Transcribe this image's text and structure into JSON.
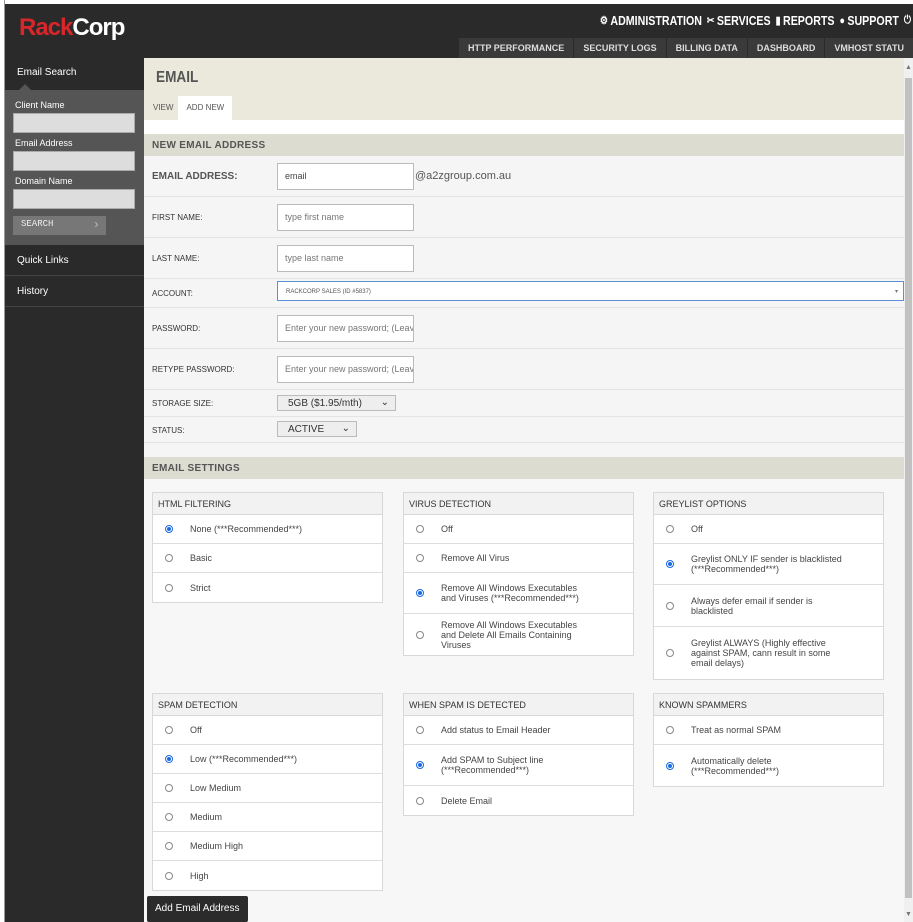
{
  "logo": {
    "part1": "Rack",
    "part2": "Corp"
  },
  "mainnav": [
    {
      "icon": "gear-icon",
      "glyph": "⚙",
      "label": "ADMINISTRATION"
    },
    {
      "icon": "tools-icon",
      "glyph": "✂",
      "label": "SERVICES"
    },
    {
      "icon": "bar-chart-icon",
      "glyph": "▮",
      "label": "REPORTS"
    },
    {
      "icon": "user-icon",
      "glyph": "●",
      "label": "SUPPORT"
    },
    {
      "icon": "power-icon",
      "glyph": "⏻",
      "label": ""
    }
  ],
  "subnav": [
    "HTTP PERFORMANCE",
    "SECURITY LOGS",
    "BILLING DATA",
    "DASHBOARD",
    "VMHOST STATU"
  ],
  "sidebar": {
    "header": "Email Search",
    "fields": [
      "Client Name",
      "Email Address",
      "Domain Name"
    ],
    "search_label": "SEARCH",
    "links": [
      "Quick Links",
      "History"
    ]
  },
  "page": {
    "title": "EMAIL",
    "tabs": [
      "VIEW",
      "ADD NEW"
    ],
    "active_tab": 1
  },
  "form": {
    "section": "NEW EMAIL ADDRESS",
    "email_label": "EMAIL ADDRESS:",
    "email_value": "email",
    "domain": "@a2zgroup.com.au",
    "first_label": "FIRST NAME:",
    "first_placeholder": "type first name",
    "last_label": "LAST NAME:",
    "last_placeholder": "type last name",
    "account_label": "ACCOUNT:",
    "account_value": "RACKCORP SALES (ID #5837)",
    "password_label": "PASSWORD:",
    "password_placeholder": "Enter your new password; (Leave",
    "retype_label": "RETYPE PASSWORD:",
    "retype_placeholder": "Enter your new password; (Leave",
    "storage_label": "STORAGE SIZE:",
    "storage_value": "5GB ($1.95/mth)",
    "status_label": "STATUS:",
    "status_value": "ACTIVE"
  },
  "settings": {
    "section": "EMAIL SETTINGS",
    "groups": [
      {
        "title": "HTML FILTERING",
        "selected": 0,
        "options": [
          "None (***Recommended***)",
          "Basic",
          "Strict"
        ]
      },
      {
        "title": "VIRUS DETECTION",
        "selected": 2,
        "options": [
          "Off",
          "Remove All Virus",
          "Remove All Windows Executables and Viruses (***Recommended***)",
          "Remove All Windows Executables and Delete All Emails Containing Viruses"
        ]
      },
      {
        "title": "GREYLIST OPTIONS",
        "selected": 1,
        "options": [
          "Off",
          "Greylist ONLY IF sender is blacklisted (***Recommended***)",
          "Always defer email if sender is blacklisted",
          "Greylist ALWAYS (Highly effective against SPAM, cann result in some email delays)"
        ]
      },
      {
        "title": "SPAM DETECTION",
        "selected": 1,
        "options": [
          "Off",
          "Low (***Recommended***)",
          "Low Medium",
          "Medium",
          "Medium High",
          "High"
        ]
      },
      {
        "title": "WHEN SPAM IS DETECTED",
        "selected": 1,
        "options": [
          "Add status to Email Header",
          "Add SPAM to Subject line (***Recommended***)",
          "Delete Email"
        ]
      },
      {
        "title": "KNOWN SPAMMERS",
        "selected": 1,
        "options": [
          "Treat as normal SPAM",
          "Automatically delete (***Recommended***)"
        ]
      }
    ]
  },
  "submit_label": "Add Email Address"
}
